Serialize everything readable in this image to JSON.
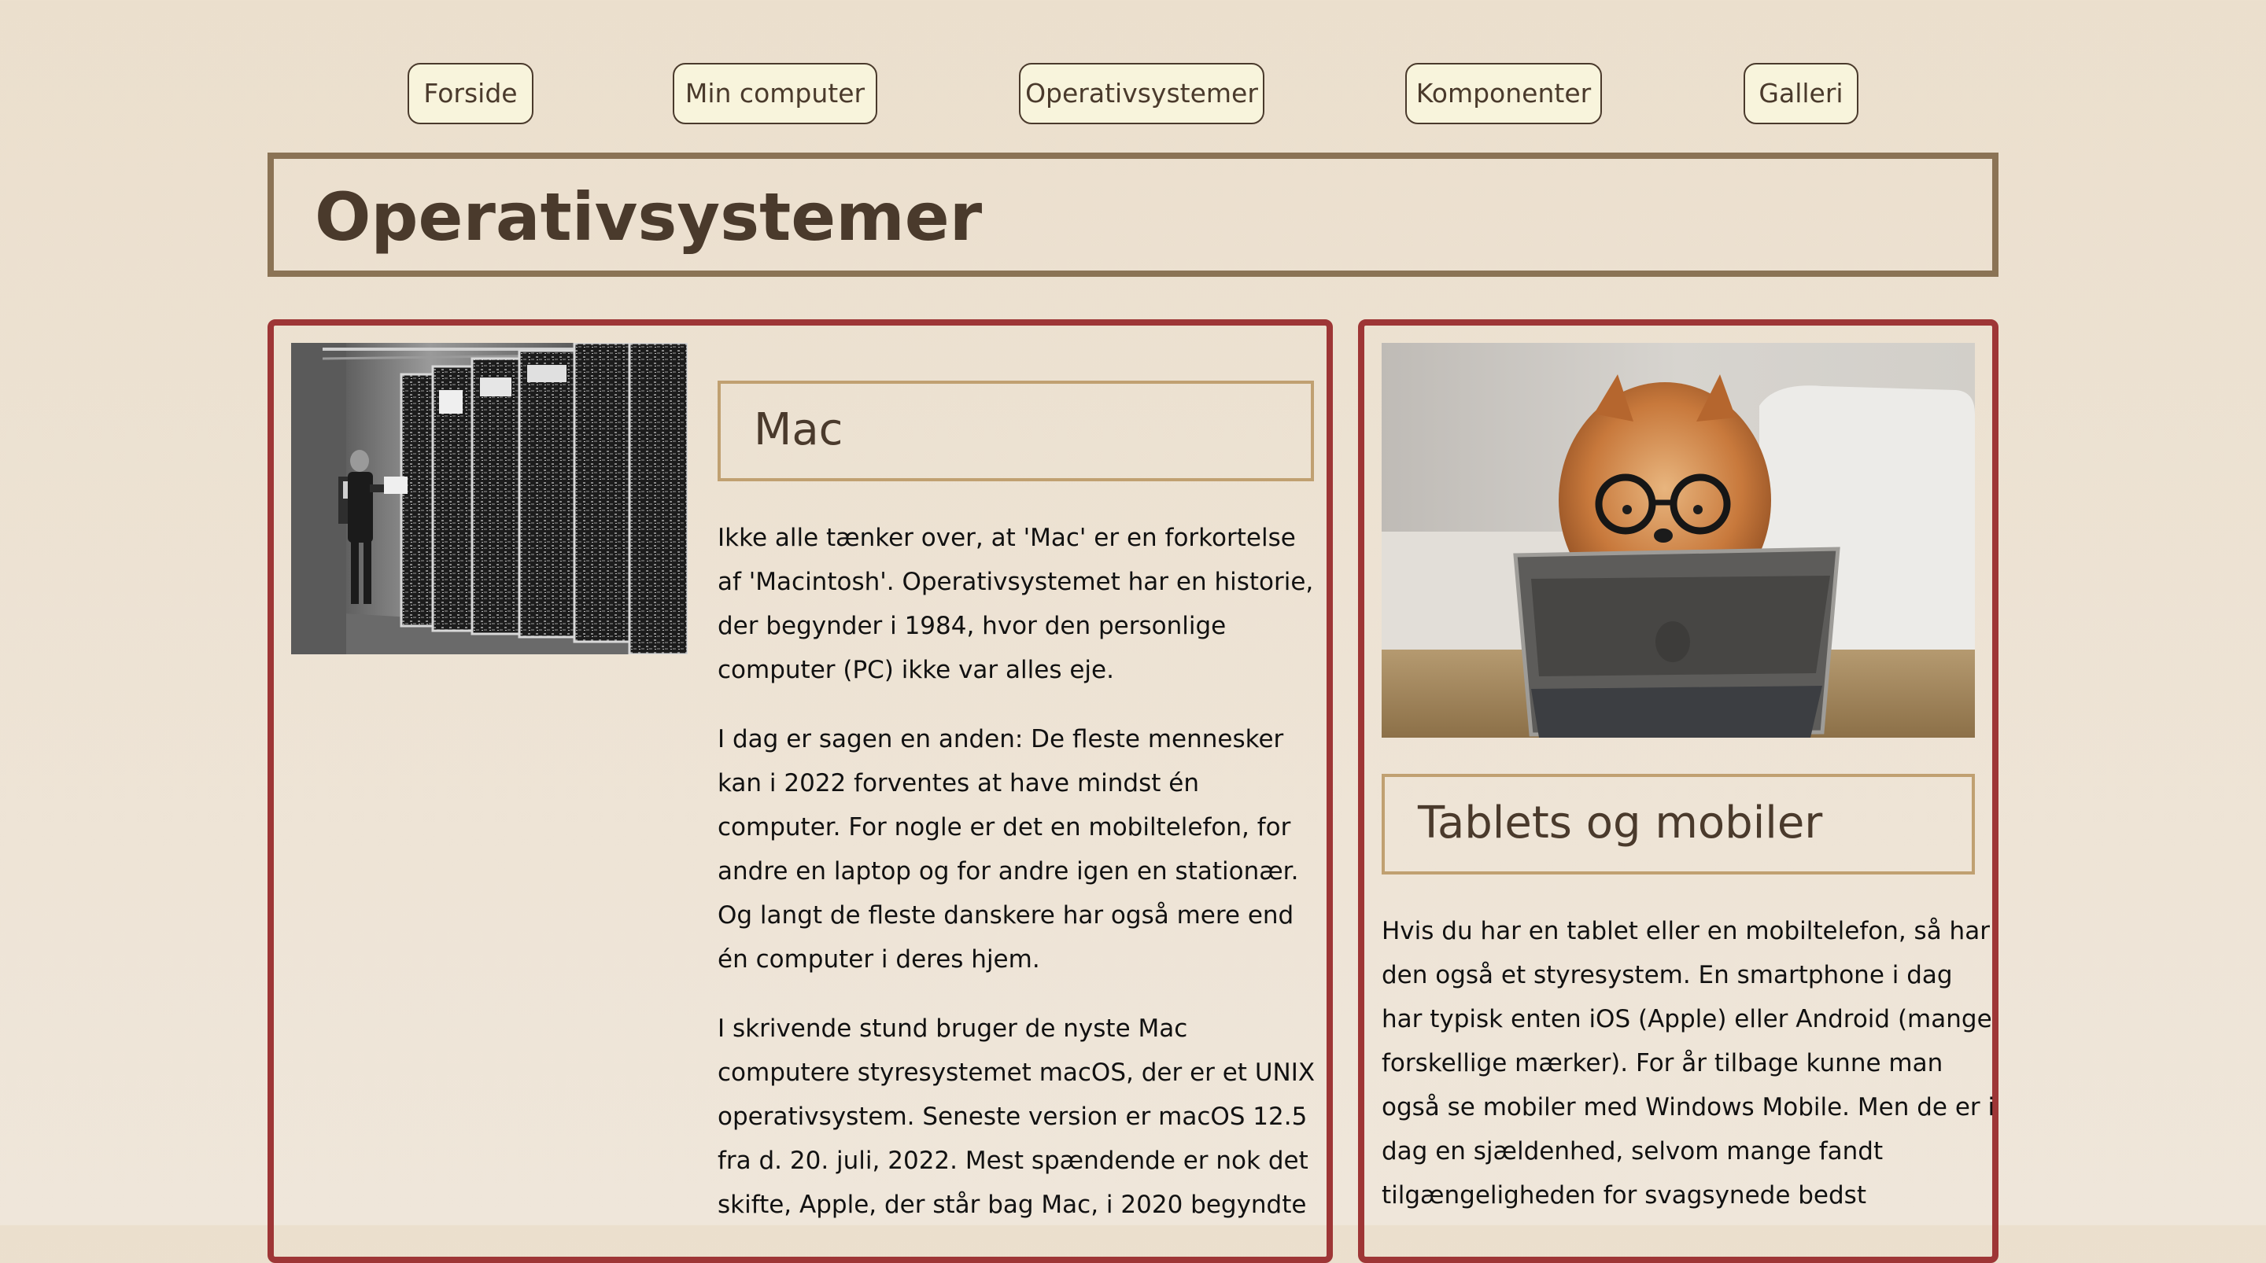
{
  "nav": {
    "items": [
      {
        "label": "Forside"
      },
      {
        "label": "Min computer"
      },
      {
        "label": "Operativsystemer"
      },
      {
        "label": "Komponenter"
      },
      {
        "label": "Galleri"
      }
    ]
  },
  "page": {
    "title": "Operativsystemer"
  },
  "mac": {
    "heading": "Mac",
    "image_icon": "mainframe-computer-photo",
    "paragraphs": [
      "Ikke alle tænker over, at 'Mac' er en forkortelse af 'Macintosh'. Operativsystemet har en historie, der begynder i 1984, hvor den personlige computer (PC) ikke var alles eje.",
      "I dag er sagen en anden: De fleste mennesker kan i 2022 forventes at have mindst én computer. For nogle er det en mobiltelefon, for andre en laptop og for andre igen en stationær. Og langt de fleste danskere har også mere end én computer i deres hjem.",
      "I skrivende stund bruger de nyste Mac computere styresystemet macOS, der er et UNIX operativsystem. Seneste version er macOS 12.5 fra d. 20. juli, 2022. Mest spændende er nok det skifte, Apple, der står bag Mac, i 2020 begyndte"
    ]
  },
  "tablets": {
    "heading": "Tablets og mobiler",
    "image_icon": "dog-with-tablet-photo",
    "paragraphs": [
      "Hvis du har en tablet eller en mobiltelefon, så har den også et styresystem. En smartphone i dag har typisk enten iOS (Apple) eller Android (mange forskellige mærker). For år tilbage kunne man også se mobiler med Windows Mobile. Men de er i dag en sjældenhed, selvom mange fandt tilgængeligheden for svagsynede bedst"
    ]
  },
  "colors": {
    "panel_border": "#9e3636",
    "title_border": "#8b7355",
    "sub_border": "#c0a071",
    "nav_bg": "#f8f4dc",
    "heading_text": "#4a3a2c"
  }
}
